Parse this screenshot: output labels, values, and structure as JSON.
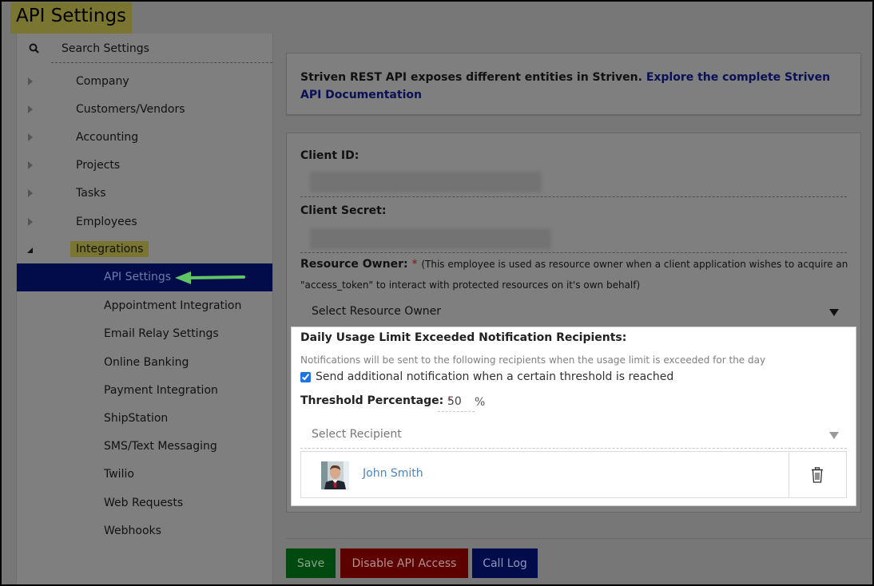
{
  "page": {
    "title": "API Settings"
  },
  "sidebar": {
    "search_label": "Search Settings",
    "items": [
      {
        "label": "Company",
        "expandable": true,
        "expanded": false
      },
      {
        "label": "Customers/Vendors",
        "expandable": true,
        "expanded": false
      },
      {
        "label": "Accounting",
        "expandable": true,
        "expanded": false
      },
      {
        "label": "Projects",
        "expandable": true,
        "expanded": false
      },
      {
        "label": "Tasks",
        "expandable": true,
        "expanded": false
      },
      {
        "label": "Employees",
        "expandable": true,
        "expanded": false
      },
      {
        "label": "Integrations",
        "expandable": true,
        "expanded": true,
        "highlighted": true
      }
    ],
    "sub_items": [
      {
        "label": "API Settings",
        "active": true
      },
      {
        "label": "Appointment Integration"
      },
      {
        "label": "Email Relay Settings"
      },
      {
        "label": "Online Banking"
      },
      {
        "label": "Payment Integration"
      },
      {
        "label": "ShipStation"
      },
      {
        "label": "SMS/Text Messaging"
      },
      {
        "label": "Twilio"
      },
      {
        "label": "Web Requests"
      },
      {
        "label": "Webhooks"
      }
    ]
  },
  "info": {
    "text": "Striven REST API exposes different entities in Striven.",
    "link": "Explore the complete Striven API Documentation"
  },
  "form": {
    "client_id_label": "Client ID:",
    "client_secret_label": "Client Secret:",
    "resource_owner_label": "Resource Owner:",
    "required_mark": "*",
    "resource_owner_note_1": "(This employee is used as resource owner when a client application wishes to acquire an",
    "resource_owner_note_2": "\"access_token\" to interact with protected resources on it's own behalf)",
    "resource_owner_placeholder": "Select Resource Owner"
  },
  "notifications": {
    "title": "Daily Usage Limit Exceeded Notification Recipients:",
    "description": "Notifications will be sent to the following recipients when the usage limit is exceeded for the day",
    "checkbox_label": "Send additional notification when a certain threshold is reached",
    "checkbox_checked": true,
    "threshold_label": "Threshold Percentage:",
    "threshold_value": "50",
    "threshold_unit": "%",
    "recipient_placeholder": "Select Recipient",
    "recipients": [
      {
        "name": "John Smith"
      }
    ]
  },
  "buttons": {
    "save": "Save",
    "disable": "Disable API Access",
    "call_log": "Call Log"
  },
  "colors": {
    "active_nav": "#020c4a",
    "save": "#004a0f",
    "disable": "#5c0000",
    "call_log": "#020c4a",
    "highlight": "#7a7530",
    "annotation_arrow": "#5fc463",
    "link": "#4a86c5"
  }
}
